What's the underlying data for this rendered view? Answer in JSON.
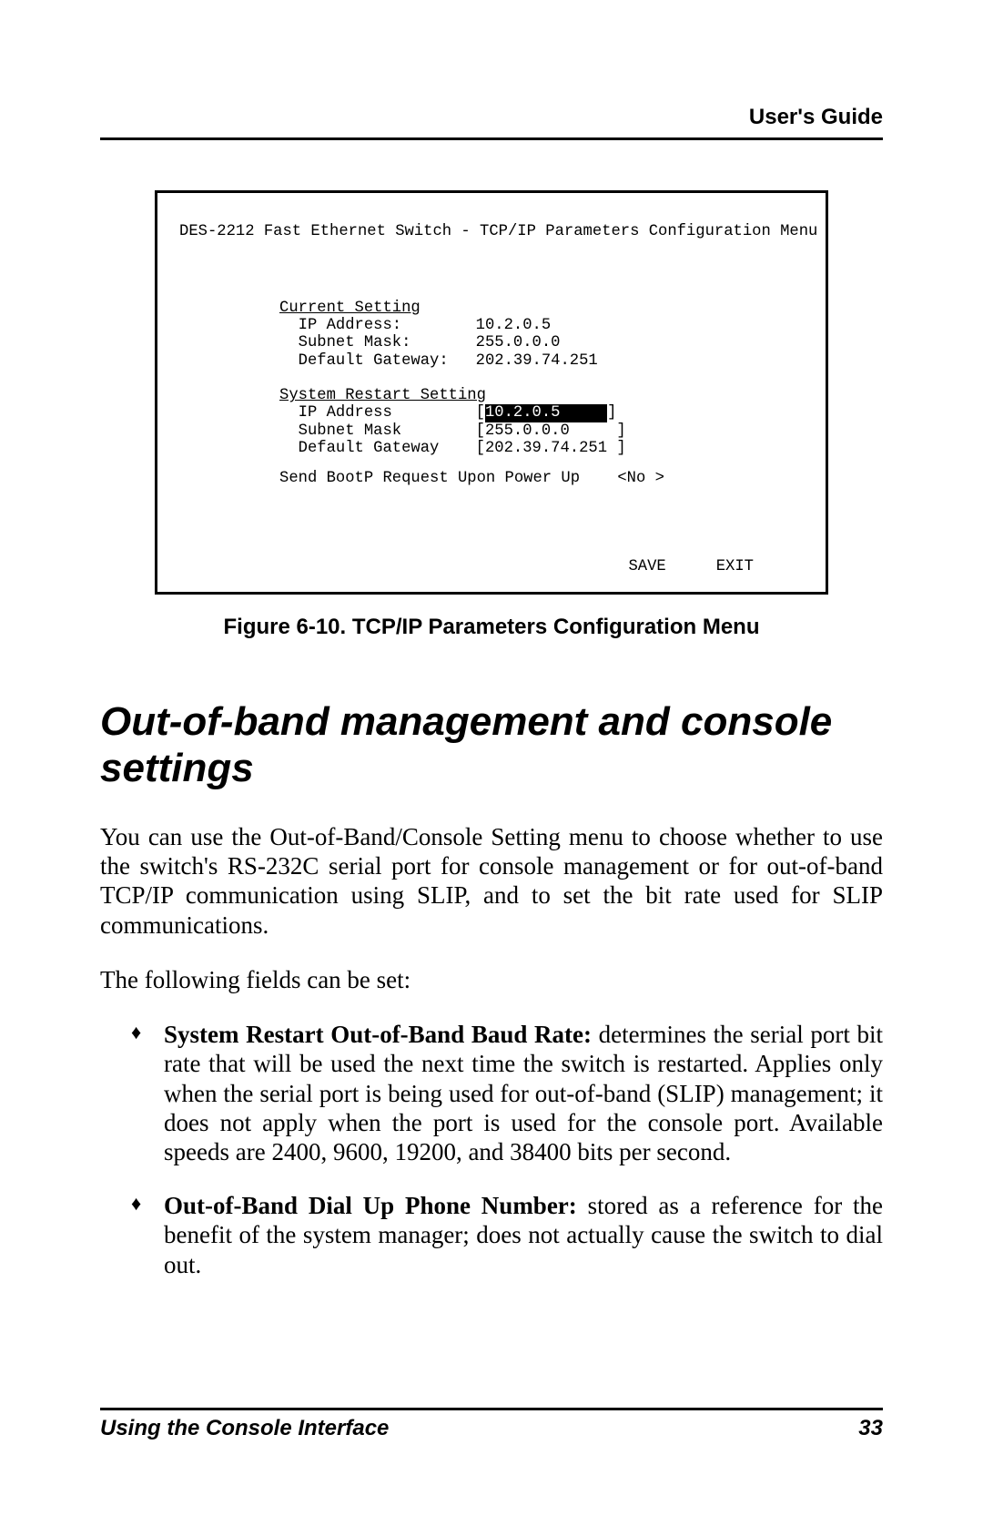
{
  "header": {
    "title": "User's Guide"
  },
  "figure": {
    "title": "DES-2212 Fast Ethernet Switch - TCP/IP Parameters Configuration Menu",
    "current": {
      "heading": "Current Setting",
      "ip_label": "IP Address:",
      "ip_value": "10.2.0.5",
      "mask_label": "Subnet Mask:",
      "mask_value": "255.0.0.0",
      "gw_label": "Default Gateway:",
      "gw_value": "202.39.74.251"
    },
    "restart": {
      "heading": "System Restart Setting",
      "ip_label": "IP Address",
      "ip_value": "10.2.0.5",
      "mask_label": "Subnet Mask",
      "mask_value": "255.0.0.0",
      "gw_label": "Default Gateway",
      "gw_value": "202.39.74.251"
    },
    "bootp_label": "Send BootP Request Upon Power Up",
    "bootp_value": "<No >",
    "save": "SAVE",
    "exit": "EXIT"
  },
  "caption": "Figure 6-10. TCP/IP Parameters Configuration Menu",
  "heading": "Out-of-band management and console settings",
  "para1": "You can use the Out-of-Band/Console Setting menu to choose whether to use the switch's RS-232C serial port for console management or for out-of-band TCP/IP communication using SLIP, and to set the bit rate used for SLIP communications.",
  "para2": "The following fields can be set:",
  "bullets": [
    {
      "lead": "System Restart Out-of-Band Baud Rate: ",
      "rest": "determines the serial port bit rate that will be used the next time the switch is restarted.  Applies only when the serial port is being used for out-of-band (SLIP) management; it does not apply when the port is used for the console port.  Available speeds are 2400, 9600, 19200, and 38400 bits per second."
    },
    {
      "lead": "Out-of-Band Dial Up Phone Number: ",
      "rest": "stored as a reference for the benefit of the system manager; does not actually cause the switch to dial out."
    }
  ],
  "footer": {
    "left": "Using the Console Interface",
    "right": "33"
  }
}
